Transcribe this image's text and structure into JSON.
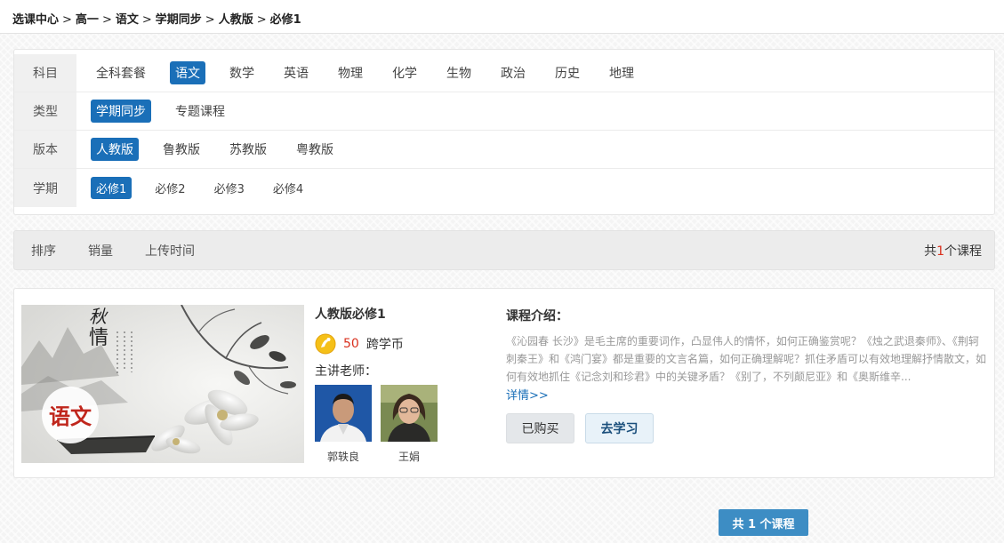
{
  "breadcrumb": [
    "选课中心",
    "高一",
    "语文",
    "学期同步",
    "人教版",
    "必修1"
  ],
  "breadcrumb_separator": ">",
  "filters": {
    "subject": {
      "label": "科目",
      "options": [
        "全科套餐",
        "语文",
        "数学",
        "英语",
        "物理",
        "化学",
        "生物",
        "政治",
        "历史",
        "地理"
      ],
      "selected": "语文"
    },
    "type": {
      "label": "类型",
      "options": [
        "学期同步",
        "专题课程"
      ],
      "selected": "学期同步"
    },
    "edition": {
      "label": "版本",
      "options": [
        "人教版",
        "鲁教版",
        "苏教版",
        "粤教版"
      ],
      "selected": "人教版"
    },
    "term": {
      "label": "学期",
      "options": [
        "必修1",
        "必修2",
        "必修3",
        "必修4"
      ],
      "selected": "必修1"
    }
  },
  "sort": {
    "label": "排序",
    "options": [
      "销量",
      "上传时间"
    ],
    "count_prefix": "共",
    "count": "1",
    "count_suffix": "个课程"
  },
  "course": {
    "cover_text": "语文",
    "title": "人教版必修1",
    "price": "50",
    "currency": "跨学币",
    "teacher_label": "主讲老师：",
    "teachers": [
      {
        "name": "郭轶良"
      },
      {
        "name": "王娟"
      }
    ],
    "intro_label": "课程介绍：",
    "intro_text": "《沁园春 长沙》是毛主席的重要词作，凸显伟人的情怀，如何正确鉴赏呢？《烛之武退秦师》、《荆轲刺秦王》和《鸿门宴》都是重要的文言名篇，如何正确理解呢？抓住矛盾可以有效地理解抒情散文，如何有效地抓住《记念刘和珍君》中的关键矛盾？《别了，不列颠尼亚》和《奥斯维辛...",
    "more_label": "详情>>",
    "bought_label": "已购买",
    "study_label": "去学习"
  },
  "footer": {
    "count_label": "共 1 个课程"
  },
  "colors": {
    "accent": "#1a6fb8",
    "price": "#d9301e",
    "badge": "#3d8dc4"
  },
  "icons": {
    "coin": "coin-icon"
  }
}
